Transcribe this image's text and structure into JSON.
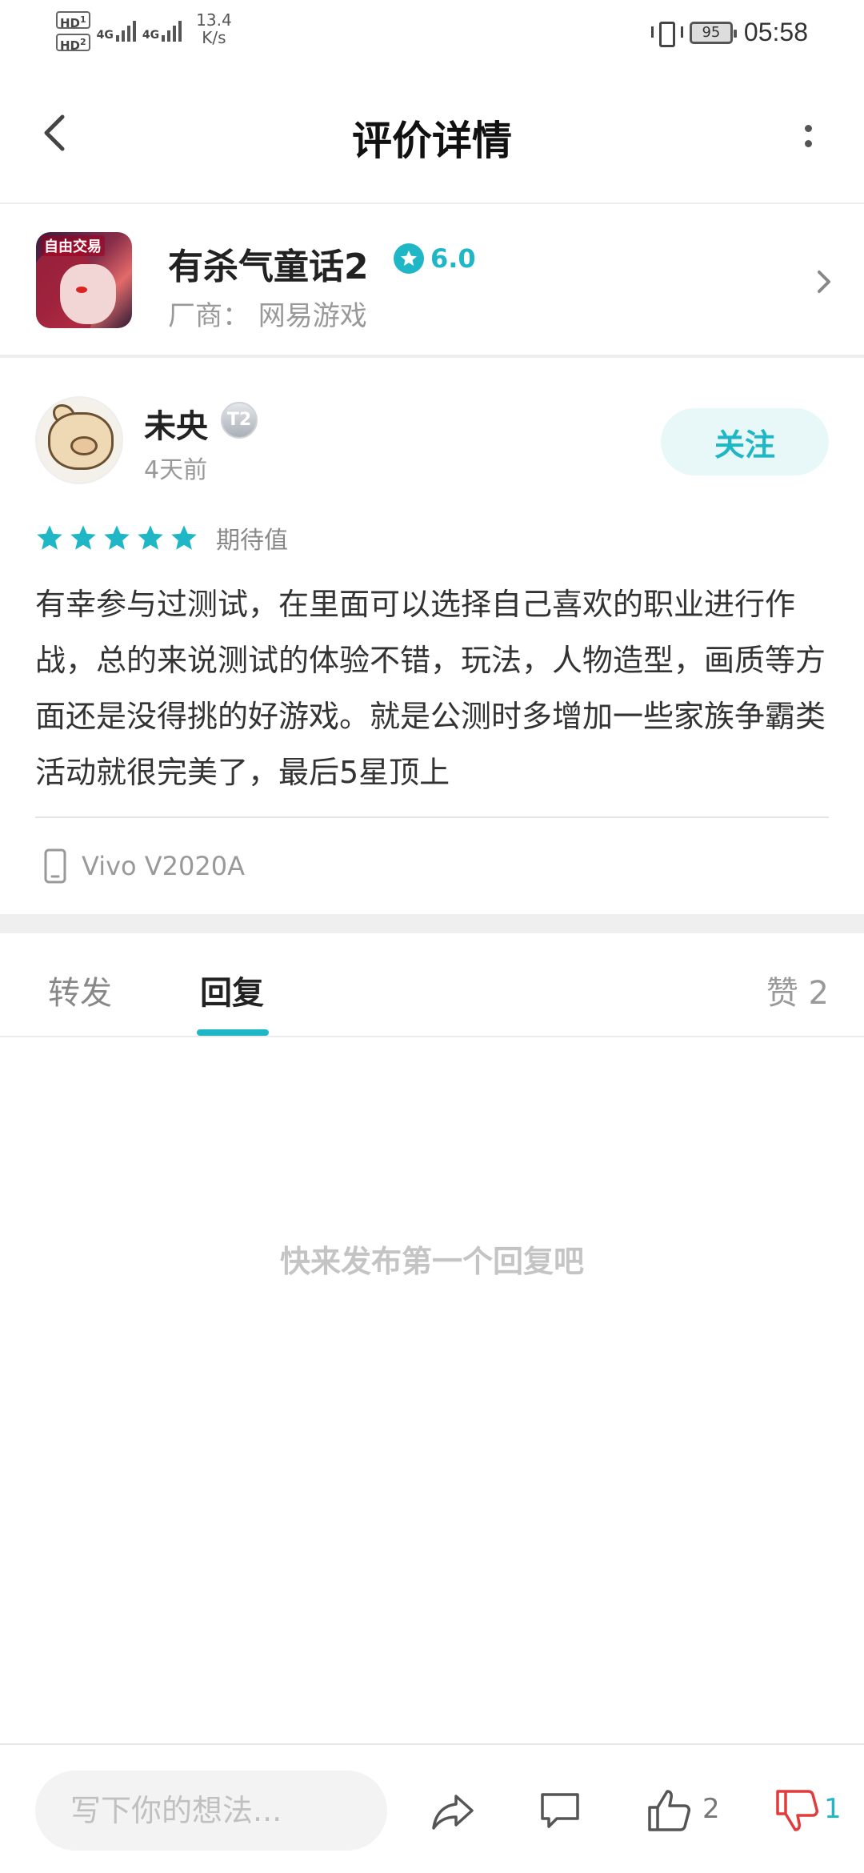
{
  "status_bar": {
    "sim1": "HD",
    "sim1_index": "1",
    "sim2": "HD",
    "sim2_index": "2",
    "net1": "4G",
    "net2": "4G",
    "speed_value": "13.4",
    "speed_unit": "K/s",
    "battery": "95",
    "time": "05:58"
  },
  "header": {
    "title": "评价详情"
  },
  "game": {
    "icon_badge": "自由交易",
    "name": "有杀气童话2",
    "rating": "6.0",
    "vendor": "厂商：  网易游戏"
  },
  "review": {
    "username": "未央",
    "level": "T2",
    "time_ago": "4天前",
    "follow_label": "关注",
    "stars": 5,
    "stars_label": "期待值",
    "text": "有幸参与过测试，在里面可以选择自己喜欢的职业进行作战，总的来说测试的体验不错，玩法，人物造型，画质等方面还是没得挑的好游戏。就是公测时多增加一些家族争霸类活动就很完美了，最后5星顶上",
    "device": "Vivo V2020A"
  },
  "tabs": {
    "items": [
      {
        "label": "转发"
      },
      {
        "label": "回复"
      }
    ],
    "likes_label": "赞 2"
  },
  "replies": {
    "empty_text": "快来发布第一个回复吧"
  },
  "bottom_bar": {
    "input_placeholder": "写下你的想法...",
    "like_count": "2",
    "dislike_count": "1"
  },
  "colors": {
    "accent": "#1fb7c6",
    "dislike": "#e23b3b",
    "text_primary": "#222222",
    "text_secondary": "#999999"
  }
}
